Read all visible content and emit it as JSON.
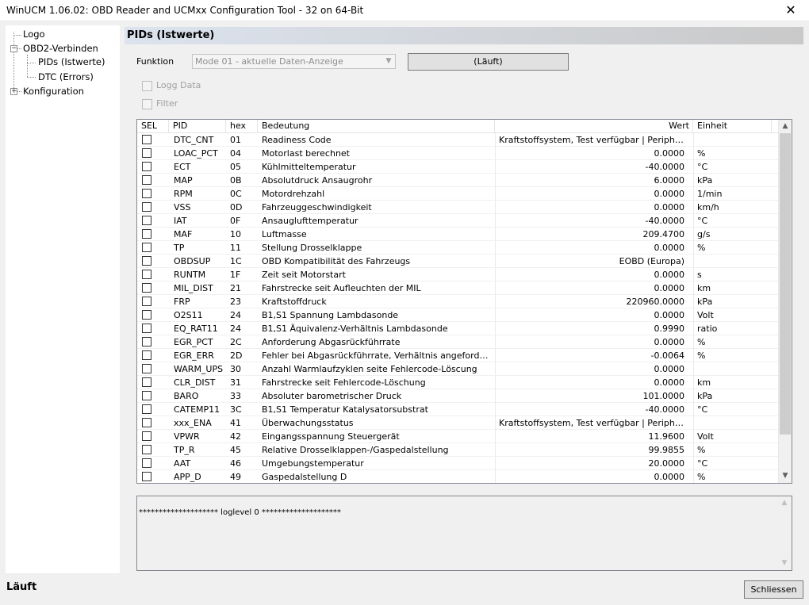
{
  "window": {
    "title": "WinUCM 1.06.02: OBD Reader and UCMxx Configuration Tool - 32 on 64-Bit",
    "close_glyph": "✕"
  },
  "tree": {
    "logo": "Logo",
    "obd": "OBD2-Verbinden",
    "pids": "PIDs (Istwerte)",
    "dtc": "DTC (Errors)",
    "config": "Konfiguration",
    "collapse_glyph": "−",
    "expand_glyph": "+"
  },
  "panel": {
    "header": "PIDs (Istwerte)",
    "funktion_label": "Funktion",
    "funktion_value": "Mode 01 - aktuelle Daten-Anzeige",
    "run_button": "(Läuft)",
    "logg_data": "Logg Data",
    "filter": "Filter"
  },
  "table": {
    "headers": {
      "sel": "SEL",
      "pid": "PID",
      "hex": "hex",
      "bedeutung": "Bedeutung",
      "wert": "Wert",
      "einheit": "Einheit"
    },
    "rows": [
      {
        "pid": "DTC_CNT",
        "hex": "01",
        "bed": "Readiness Code",
        "wert": "Kraftstoffsystem, Test verfügbar | Periphere B...",
        "ein": "",
        "align": "left"
      },
      {
        "pid": "LOAC_PCT",
        "hex": "04",
        "bed": "Motorlast berechnet",
        "wert": "0.0000",
        "ein": "%"
      },
      {
        "pid": "ECT",
        "hex": "05",
        "bed": "Kühlmitteltemperatur",
        "wert": "-40.0000",
        "ein": "°C"
      },
      {
        "pid": "MAP",
        "hex": "0B",
        "bed": "Absolutdruck Ansaugrohr",
        "wert": "6.0000",
        "ein": "kPa"
      },
      {
        "pid": "RPM",
        "hex": "0C",
        "bed": "Motordrehzahl",
        "wert": "0.0000",
        "ein": "1/min"
      },
      {
        "pid": "VSS",
        "hex": "0D",
        "bed": "Fahrzeuggeschwindigkeit",
        "wert": "0.0000",
        "ein": "km/h"
      },
      {
        "pid": "IAT",
        "hex": "0F",
        "bed": "Ansauglufttemperatur",
        "wert": "-40.0000",
        "ein": "°C"
      },
      {
        "pid": "MAF",
        "hex": "10",
        "bed": "Luftmasse",
        "wert": "209.4700",
        "ein": "g/s"
      },
      {
        "pid": "TP",
        "hex": "11",
        "bed": "Stellung Drosselklappe",
        "wert": "0.0000",
        "ein": "%"
      },
      {
        "pid": "OBDSUP",
        "hex": "1C",
        "bed": "OBD Kompatibilität des Fahrzeugs",
        "wert": "EOBD (Europa)",
        "ein": ""
      },
      {
        "pid": "RUNTM",
        "hex": "1F",
        "bed": "Zeit seit Motorstart",
        "wert": "0.0000",
        "ein": "s"
      },
      {
        "pid": "MIL_DIST",
        "hex": "21",
        "bed": "Fahrstrecke seit Aufleuchten der MIL",
        "wert": "0.0000",
        "ein": "km"
      },
      {
        "pid": "FRP",
        "hex": "23",
        "bed": "Kraftstoffdruck",
        "wert": "220960.0000",
        "ein": "kPa"
      },
      {
        "pid": "O2S11",
        "hex": "24",
        "bed": "B1,S1 Spannung Lambdasonde",
        "wert": "0.0000",
        "ein": "Volt"
      },
      {
        "pid": "EQ_RAT11",
        "hex": "24",
        "bed": "B1,S1 Äquivalenz-Verhältnis Lambdasonde",
        "wert": "0.9990",
        "ein": "ratio"
      },
      {
        "pid": "EGR_PCT",
        "hex": "2C",
        "bed": "Anforderung Abgasrückführrate",
        "wert": "0.0000",
        "ein": "%"
      },
      {
        "pid": "EGR_ERR",
        "hex": "2D",
        "bed": "Fehler bei Abgasrückführrate, Verhältnis angeforderter z...",
        "wert": "-0.0064",
        "ein": "%"
      },
      {
        "pid": "WARM_UPS",
        "hex": "30",
        "bed": "Anzahl Warmlaufzyklen seite Fehlercode-Löscung",
        "wert": "0.0000",
        "ein": ""
      },
      {
        "pid": "CLR_DIST",
        "hex": "31",
        "bed": "Fahrstrecke seit Fehlercode-Löschung",
        "wert": "0.0000",
        "ein": "km"
      },
      {
        "pid": "BARO",
        "hex": "33",
        "bed": "Absoluter barometrischer Druck",
        "wert": "101.0000",
        "ein": "kPa"
      },
      {
        "pid": "CATEMP11",
        "hex": "3C",
        "bed": "B1,S1 Temperatur Katalysatorsubstrat",
        "wert": "-40.0000",
        "ein": "°C"
      },
      {
        "pid": "xxx_ENA",
        "hex": "41",
        "bed": "Überwachungsstatus",
        "wert": "Kraftstoffsystem, Test verfügbar | Periphere B...",
        "ein": "",
        "align": "left"
      },
      {
        "pid": "VPWR",
        "hex": "42",
        "bed": "Eingangsspannung Steuergerät",
        "wert": "11.9600",
        "ein": "Volt"
      },
      {
        "pid": "TP_R",
        "hex": "45",
        "bed": "Relative Drosselklappen-/Gaspedalstellung",
        "wert": "99.9855",
        "ein": "%"
      },
      {
        "pid": "AAT",
        "hex": "46",
        "bed": "Umgebungstemperatur",
        "wert": "20.0000",
        "ein": "°C"
      },
      {
        "pid": "APP_D",
        "hex": "49",
        "bed": "Gaspedalstellung D",
        "wert": "0.0000",
        "ein": "%"
      }
    ]
  },
  "log": {
    "text": "******************** loglevel 0 ********************"
  },
  "status": {
    "text": "Läuft",
    "close_button": "Schliessen"
  },
  "scroll": {
    "up_glyph": "▲",
    "down_glyph": "▼"
  }
}
